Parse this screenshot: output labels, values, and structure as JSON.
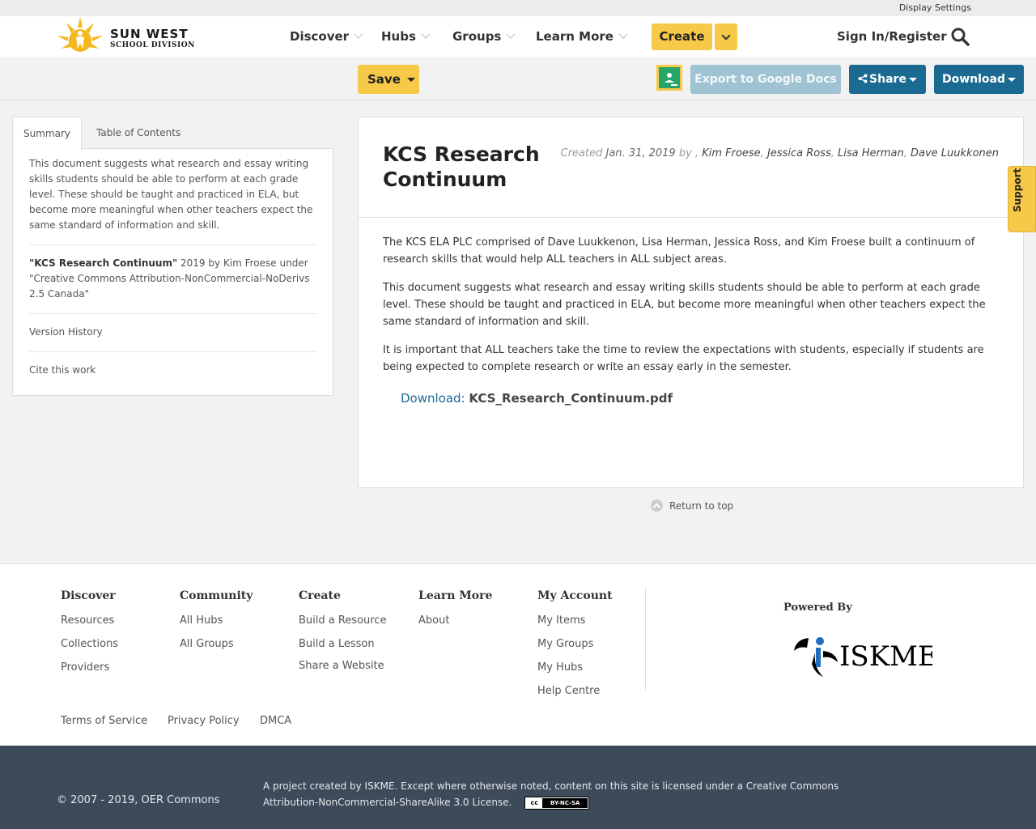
{
  "util": {
    "display_settings": "Display Settings"
  },
  "brand": {
    "name_line1": "SUN WEST",
    "name_line2": "SCHOOL DIVISION",
    "sun_color": "#f5b81c"
  },
  "nav": {
    "discover": "Discover",
    "hubs": "Hubs",
    "groups": "Groups",
    "learn_more": "Learn More",
    "create": "Create",
    "signin": "Sign In/Register"
  },
  "toolbar": {
    "save": "Save",
    "export": "Export to Google Docs",
    "share": "Share",
    "download": "Download"
  },
  "left_panel": {
    "tabs": [
      "Summary",
      "Table of Contents"
    ],
    "summary": "This document suggests what research and essay writing skills students should be able to perform at each grade level. These should be taught and practiced in ELA, but become more meaningful when other teachers expect the same standard of information and skill.",
    "attribution_title": "\"KCS Research Continuum\"",
    "attribution_rest": " 2019 by Kim Froese under \"Creative Commons Attribution-NonCommercial-NoDerivs 2.5 Canada\"",
    "version_history": "Version History",
    "cite": "Cite this work"
  },
  "document": {
    "title": "KCS Research Continuum",
    "created_label": "Created",
    "created_date": "Jan. 31, 2019",
    "by_label": "by ,",
    "authors": [
      "Kim Froese",
      "Jessica Ross",
      "Lisa Herman",
      "Dave Luukkonen"
    ],
    "paragraphs": [
      "The KCS ELA PLC comprised of Dave Luukkenon, Lisa Herman, Jessica Ross, and Kim Froese built a continuum of research skills that would help ALL teachers in ALL subject areas.",
      "This document suggests what research and essay writing skills students should be able to perform  at each grade level. These should be taught and practiced in ELA, but become more meaningful when other teachers expect the same standard of information and skill.",
      "It is important that ALL teachers take the time to review the expectations with students, especially if students are being expected to complete research or write an essay early in the semester."
    ],
    "download_label": "Download:",
    "download_file": "KCS_Research_Continuum.pdf"
  },
  "return_top": "Return to top",
  "support": "Support",
  "footer": {
    "discover": {
      "title": "Discover",
      "links": [
        "Resources",
        "Collections",
        "Providers"
      ]
    },
    "community": {
      "title": "Community",
      "links": [
        "All Hubs",
        "All Groups"
      ]
    },
    "create": {
      "title": "Create",
      "links": [
        "Build a Resource",
        "Build a Lesson",
        "Share a Website"
      ]
    },
    "learn_more": {
      "title": "Learn More",
      "links": [
        "About"
      ]
    },
    "my_account": {
      "title": "My Account",
      "links": [
        "My Items",
        "My Groups",
        "My Hubs",
        "Help Centre"
      ]
    },
    "powered_by": "Powered By",
    "iskme": "ISKME",
    "legal": [
      "Terms of Service",
      "Privacy Policy",
      "DMCA"
    ],
    "copyright": "© 2007 - 2019, OER Commons",
    "license": "A project created by ISKME. Except where otherwise noted, content on this site is licensed under a Creative Commons Attribution-NonCommercial-ShareAlike 3.0 License.",
    "cc_badge": {
      "cc": "cc",
      "terms": "BY-NC-SA"
    }
  },
  "colors": {
    "accent_yellow": "#f7c948",
    "primary_blue": "#1b6a92",
    "footer_dark": "#3d4a5a"
  }
}
